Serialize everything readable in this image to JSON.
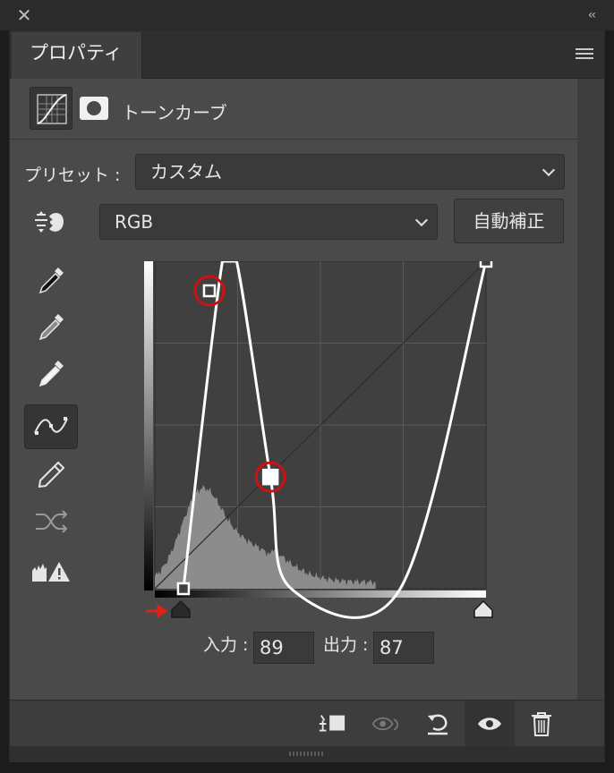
{
  "window": {
    "close_icon": "close-icon",
    "collapse_label": "‹‹"
  },
  "panel": {
    "tab_title": "プロパティ",
    "adjustment_label": "トーンカーブ"
  },
  "preset": {
    "label": "プリセット :",
    "value": "カスタム"
  },
  "channel": {
    "value": "RGB"
  },
  "auto_button": "自動補正",
  "tools": [
    "sample-black-point-icon",
    "sample-gray-point-icon",
    "sample-white-point-icon",
    "edit-curve-points-icon",
    "draw-curve-pencil-icon",
    "smooth-curve-icon",
    "clipping-warning-icon"
  ],
  "curve": {
    "input_label": "入力 :",
    "input_value": "89",
    "output_label": "出力 :",
    "output_value": "87",
    "points": [
      [
        22,
        0
      ],
      [
        52,
        255
      ],
      [
        63,
        255
      ],
      [
        89,
        87
      ],
      [
        105,
        0
      ],
      [
        189,
        0
      ],
      [
        255,
        255
      ]
    ],
    "selected_points": [
      [
        42,
        232
      ],
      [
        89,
        87
      ]
    ],
    "black_input": 22,
    "white_input": 255
  },
  "bottom_actions": [
    "clip-to-layer-icon",
    "view-previous-state-icon",
    "reset-icon",
    "visibility-eye-icon",
    "delete-icon"
  ],
  "colors": {
    "panel_bg": "#4a4a4a",
    "selection_ring": "#d01010",
    "marker_arrow": "#e0201a"
  }
}
